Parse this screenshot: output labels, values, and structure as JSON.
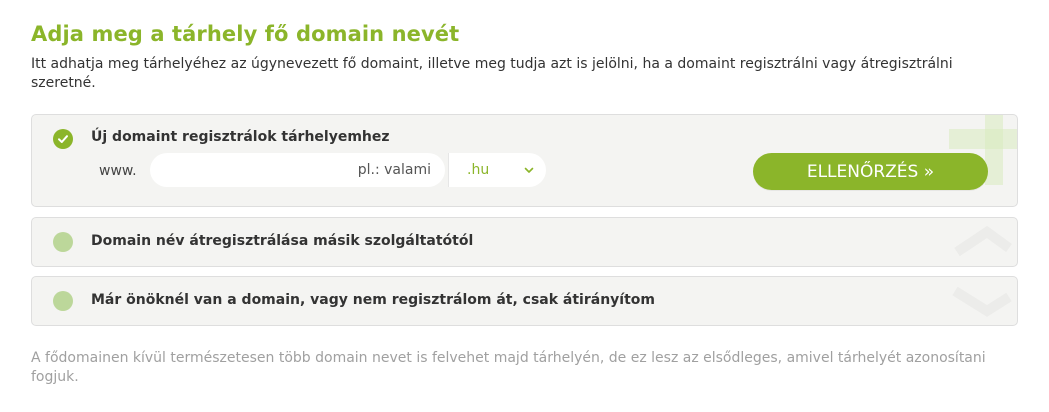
{
  "heading": "Adja meg a tárhely fő domain nevét",
  "intro": "Itt adhatja meg tárhelyéhez az úgynevezett fő domaint, illetve meg tudja azt is jelölni, ha a domaint regisztrálni vagy átregisztrálni szeretné.",
  "options": [
    {
      "label": "Új domaint regisztrálok tárhelyemhez",
      "selected": true,
      "www_prefix": "www.",
      "domain_placeholder": "pl.: valami",
      "domain_value": "",
      "tld_selected": ".hu",
      "button_label": "ELLENŐRZÉS »"
    },
    {
      "label": "Domain név átregisztrálása másik szolgáltatótól",
      "selected": false
    },
    {
      "label": "Már önöknél van a domain, vagy nem regisztrálom át, csak átirányítom",
      "selected": false
    }
  ],
  "footnote": "A fődomainen kívül természetesen több domain nevet is felvehet majd tárhelyén, de ez lesz az elsődleges, amivel tárhelyét azonosítani fogjuk.",
  "colors": {
    "accent": "#8bb52a",
    "radio_unselected": "#bcd79a",
    "card_bg": "#f4f4f2",
    "muted_text": "#a0a0a0"
  },
  "icons": {
    "selected_radio": "check-icon",
    "tld_select": "chevron-down-icon"
  }
}
